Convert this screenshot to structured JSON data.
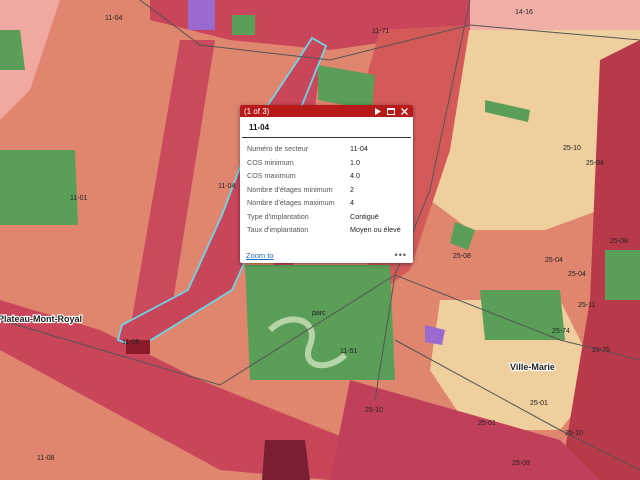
{
  "map": {
    "sector_labels": {
      "s1104_top": "11-04",
      "s1171": "11-71",
      "s1416": "14-16",
      "s1101": "11-01",
      "s1104_mid": "11-04",
      "s1106": "11-06",
      "s1108": "11-08",
      "s1151": "11-51",
      "s2510": "25-10",
      "s2504_a": "25-04",
      "s2504_b": "25-04",
      "s2508_a": "25-08",
      "s2508_b": "25-08",
      "s2511": "25-11",
      "s2504_c": "25-04",
      "s2574": "25-74",
      "s2576": "25-76",
      "s2501_a": "25-01",
      "s2501_b": "25-01",
      "s2510_b": "25-10",
      "s2510_c": "25-10",
      "s2509": "25-09"
    },
    "place_labels": {
      "plateau": "Plateau-Mont-Royal",
      "ville_marie": "Ville-Marie",
      "parc": "parc"
    },
    "colors": {
      "background": "#e0866f",
      "salmon": "#e8907a",
      "pink_light": "#f0a8a0",
      "beige": "#efcf9e",
      "crimson": "#c9455a",
      "red_dark": "#a62b3c",
      "green": "#5a9e57",
      "purple": "#9a6ad0",
      "highlight": "#6cd6e8"
    }
  },
  "popup": {
    "counter": "(1 of 3)",
    "title": "11-04",
    "fields": [
      {
        "key": "Numéro de secteur",
        "value": "11-04"
      },
      {
        "key": "COS minimum",
        "value": "1.0"
      },
      {
        "key": "COS maximum",
        "value": "4.0"
      },
      {
        "key": "Nombre d'étages minimum",
        "value": "2"
      },
      {
        "key": "Nombre d'étages maximum",
        "value": "4"
      },
      {
        "key": "Type d'implantation",
        "value": "Contiguë"
      },
      {
        "key": "Taux d'implantation",
        "value": "Moyen ou élevé"
      }
    ],
    "zoom_label": "Zoom to",
    "more_label": "•••"
  }
}
